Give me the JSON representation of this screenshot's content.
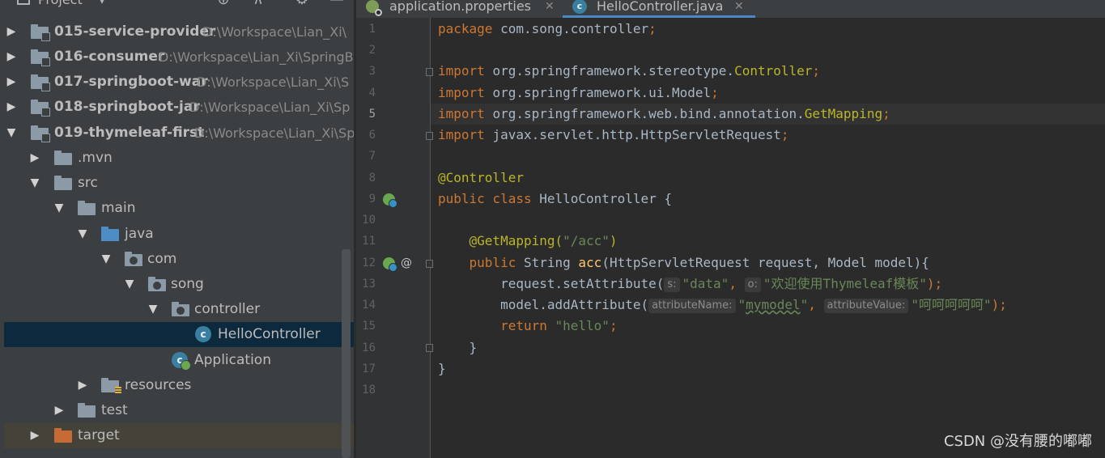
{
  "project_panel": {
    "title": "Project",
    "tree": [
      {
        "label": "015-service-provider",
        "path": "D:\\Workspace\\Lian_Xi\\"
      },
      {
        "label": "016-consumer",
        "path": "D:\\Workspace\\Lian_Xi\\SpringB"
      },
      {
        "label": "017-springboot-war",
        "path": "D:\\Workspace\\Lian_Xi\\S"
      },
      {
        "label": "018-springboot-jar",
        "path": "D:\\Workspace\\Lian_Xi\\Sp"
      },
      {
        "label": "019-thymeleaf-first",
        "path": "D:\\Workspace\\Lian_Xi\\Sp"
      },
      {
        "label": ".mvn"
      },
      {
        "label": "src"
      },
      {
        "label": "main"
      },
      {
        "label": "java"
      },
      {
        "label": "com"
      },
      {
        "label": "song"
      },
      {
        "label": "controller"
      },
      {
        "label": "HelloController"
      },
      {
        "label": "Application"
      },
      {
        "label": "resources"
      },
      {
        "label": "test"
      },
      {
        "label": "target"
      }
    ]
  },
  "editor": {
    "tabs": [
      {
        "label": "application.properties"
      },
      {
        "label": "HelloController.java"
      }
    ],
    "line_numbers": [
      "1",
      "2",
      "3",
      "4",
      "5",
      "6",
      "7",
      "8",
      "9",
      "10",
      "11",
      "12",
      "13",
      "14",
      "15",
      "16",
      "17",
      "18"
    ],
    "tokens": {
      "package_kw": "package",
      "package_name": "com.song.controller",
      "semi": ";",
      "import_kw": "import",
      "imp3_a": "org.springframework.stereotype.",
      "imp3_b": "Controller",
      "imp4": "org.springframework.ui.Model",
      "imp5_a": "org.springframework.web.bind.annotation.",
      "imp5_b": "GetMapping",
      "imp6": "javax.servlet.http.HttpServletRequest",
      "controller_ann": "@Controller",
      "public_class": "public class ",
      "class_decl": "HelloController {",
      "getmapping_ann": "@GetMapping(",
      "getmapping_val": "\"/acc\"",
      "close_paren": ")",
      "public_kw": "public ",
      "string_type": "String ",
      "method_name": "acc",
      "params": "(HttpServletRequest request, Model model){",
      "l13_call": "request.setAttribute(",
      "hint_s": "s:",
      "l13_arg1": "\"data\"",
      "comma": ", ",
      "hint_o": "o:",
      "l13_arg2": "\"欢迎使用Thymeleaf模板\"",
      "close_stmt": ");",
      "l14_call": "model.addAttribute(",
      "hint_attr_name": "attributeName:",
      "l14_arg1_quote_open": "\"",
      "l14_arg1_word": "mymodel",
      "l14_arg1_quote_close": "\"",
      "hint_attr_value": "attributeValue:",
      "l14_arg2": "\"呵呵呵呵呵\"",
      "return_kw": "return ",
      "return_val": "\"hello\"",
      "close_brace": "}"
    }
  },
  "watermark": "CSDN @没有腰的嘟嘟"
}
